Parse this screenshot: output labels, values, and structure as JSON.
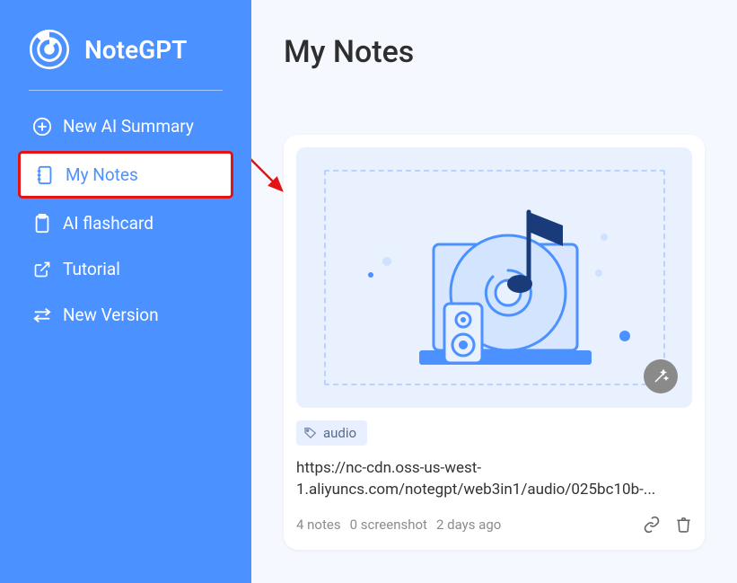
{
  "brand": "NoteGPT",
  "nav": {
    "new_summary": "New AI Summary",
    "my_notes": "My Notes",
    "flashcard": "AI flashcard",
    "tutorial": "Tutorial",
    "new_version": "New Version"
  },
  "page_title": "My Notes",
  "note": {
    "tag_label": "audio",
    "title": "https://nc-cdn.oss-us-west-1.aliyuncs.com/notegpt/web3in1/audio/025bc10b-...",
    "meta_notes": "4 notes",
    "meta_screenshot": "0 screenshot",
    "meta_time": "2 days ago"
  }
}
